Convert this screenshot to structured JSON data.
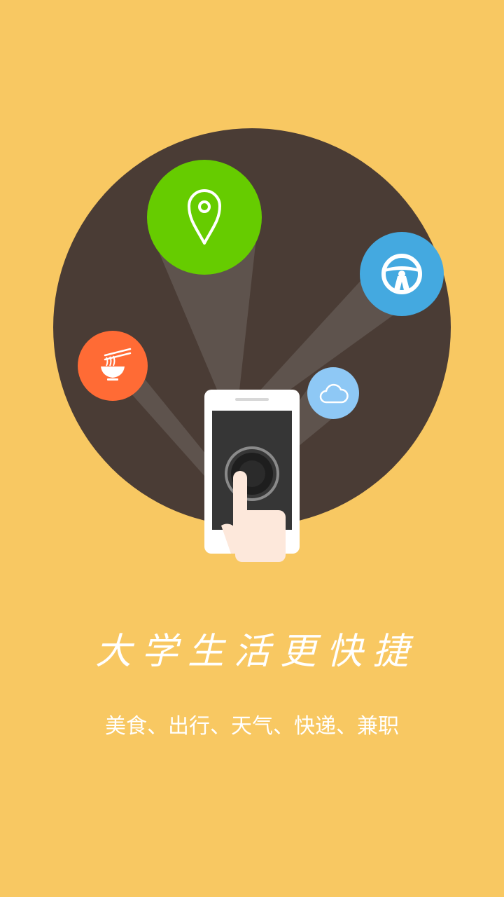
{
  "colors": {
    "background": "#F8C862",
    "disc": "#4A3C35",
    "beam": "#5E534D",
    "location": "#66CC00",
    "wheel": "#44A9E0",
    "food": "#FF6B35",
    "weather": "#8EC8F5",
    "phone_body": "#FFFFFF",
    "phone_screen": "#363636",
    "hand": "#FDE8DB"
  },
  "icons": [
    "location-pin-icon",
    "steering-wheel-icon",
    "noodle-bowl-icon",
    "cloud-icon",
    "phone-icon",
    "hand-icon"
  ],
  "headline": "大学生活更快捷",
  "subline": "美食、出行、天气、快递、兼职"
}
